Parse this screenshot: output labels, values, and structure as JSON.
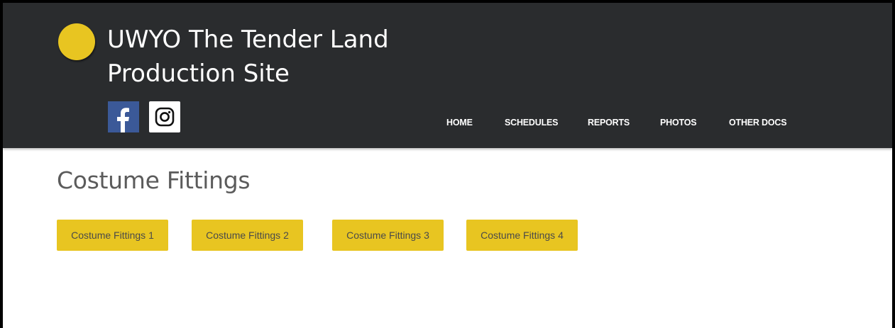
{
  "site": {
    "title": "UWYO The Tender Land Production Site",
    "accent_color": "#e8c521",
    "header_bg": "#2a2c2e"
  },
  "social": [
    {
      "name": "facebook",
      "icon": "facebook-icon",
      "label": "f"
    },
    {
      "name": "instagram",
      "icon": "instagram-icon"
    }
  ],
  "nav": {
    "items": [
      {
        "label": "HOME"
      },
      {
        "label": "SCHEDULES"
      },
      {
        "label": "REPORTS"
      },
      {
        "label": "PHOTOS"
      },
      {
        "label": "OTHER DOCS"
      }
    ]
  },
  "main": {
    "heading": "Costume Fittings",
    "buttons": [
      {
        "label": "Costume Fittings 1"
      },
      {
        "label": "Costume Fittings 2"
      },
      {
        "label": "Costume Fittings 3"
      },
      {
        "label": "Costume Fittings 4"
      }
    ]
  }
}
